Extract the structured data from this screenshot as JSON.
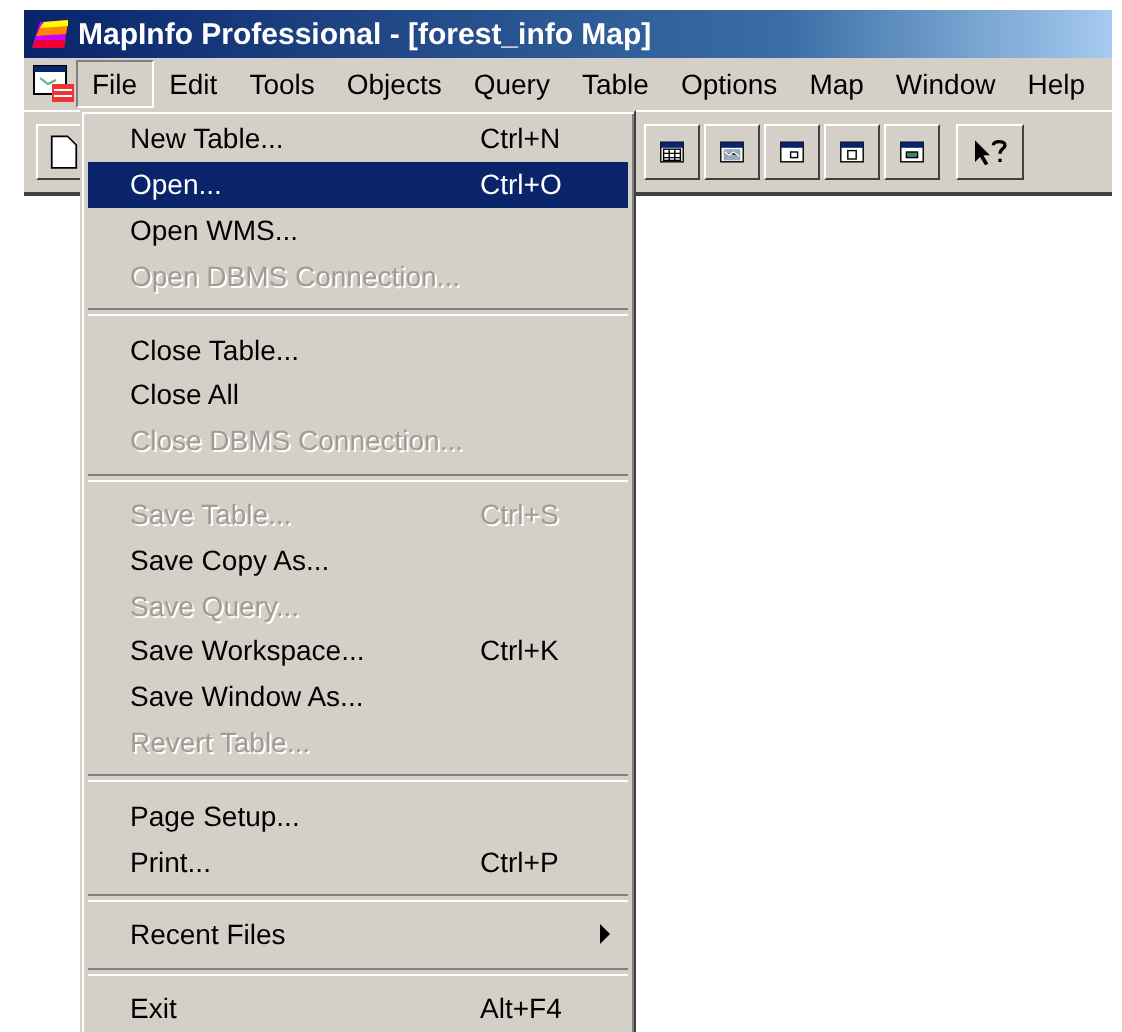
{
  "window": {
    "title": "MapInfo Professional - [forest_info Map]"
  },
  "menubar": [
    {
      "label": "File",
      "selected": true
    },
    {
      "label": "Edit",
      "selected": false
    },
    {
      "label": "Tools",
      "selected": false
    },
    {
      "label": "Objects",
      "selected": false
    },
    {
      "label": "Query",
      "selected": false
    },
    {
      "label": "Table",
      "selected": false
    },
    {
      "label": "Options",
      "selected": false
    },
    {
      "label": "Map",
      "selected": false
    },
    {
      "label": "Window",
      "selected": false
    },
    {
      "label": "Help",
      "selected": false
    }
  ],
  "file_menu": [
    {
      "kind": "item",
      "label": "New Table...",
      "shortcut": "Ctrl+N",
      "disabled": false,
      "selected": false,
      "submenu": false
    },
    {
      "kind": "item",
      "label": "Open...",
      "shortcut": "Ctrl+O",
      "disabled": false,
      "selected": true,
      "submenu": false
    },
    {
      "kind": "item",
      "label": "Open WMS...",
      "disabled": false,
      "selected": false,
      "submenu": false
    },
    {
      "kind": "item",
      "label": "Open DBMS Connection...",
      "disabled": true,
      "selected": false,
      "submenu": false
    },
    {
      "kind": "separator"
    },
    {
      "kind": "item",
      "label": "Close Table...",
      "disabled": false,
      "selected": false,
      "submenu": false
    },
    {
      "kind": "item",
      "label": "Close All",
      "disabled": false,
      "selected": false,
      "submenu": false
    },
    {
      "kind": "item",
      "label": "Close DBMS Connection...",
      "disabled": true,
      "selected": false,
      "submenu": false
    },
    {
      "kind": "separator"
    },
    {
      "kind": "item",
      "label": "Save Table...",
      "shortcut": "Ctrl+S",
      "disabled": true,
      "selected": false,
      "submenu": false
    },
    {
      "kind": "item",
      "label": "Save Copy As...",
      "disabled": false,
      "selected": false,
      "submenu": false
    },
    {
      "kind": "item",
      "label": "Save Query...",
      "disabled": true,
      "selected": false,
      "submenu": false
    },
    {
      "kind": "item",
      "label": "Save Workspace...",
      "shortcut": "Ctrl+K",
      "disabled": false,
      "selected": false,
      "submenu": false
    },
    {
      "kind": "item",
      "label": "Save Window As...",
      "disabled": false,
      "selected": false,
      "submenu": false
    },
    {
      "kind": "item",
      "label": "Revert Table...",
      "disabled": true,
      "selected": false,
      "submenu": false
    },
    {
      "kind": "separator"
    },
    {
      "kind": "item",
      "label": "Page Setup...",
      "disabled": false,
      "selected": false,
      "submenu": false
    },
    {
      "kind": "item",
      "label": "Print...",
      "shortcut": "Ctrl+P",
      "disabled": false,
      "selected": false,
      "submenu": false
    },
    {
      "kind": "separator"
    },
    {
      "kind": "item",
      "label": "Recent Files",
      "disabled": false,
      "selected": false,
      "submenu": true
    },
    {
      "kind": "separator"
    },
    {
      "kind": "item",
      "label": "Exit",
      "shortcut": "Alt+F4",
      "disabled": false,
      "selected": false,
      "submenu": false
    }
  ]
}
